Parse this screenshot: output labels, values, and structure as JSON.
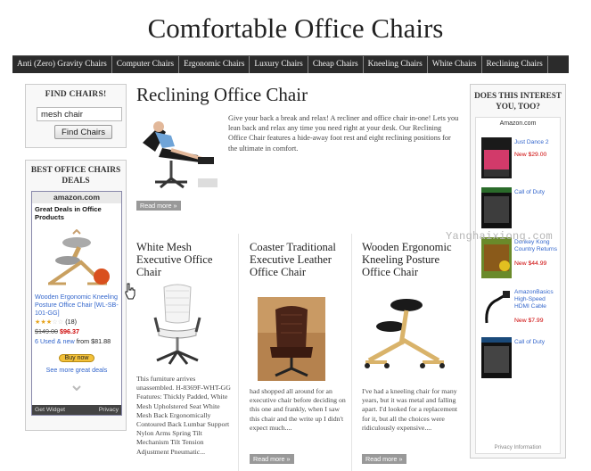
{
  "site": {
    "title": "Comfortable Office Chairs"
  },
  "nav": [
    "Anti (Zero) Gravity Chairs",
    "Computer Chairs",
    "Ergonomic Chairs",
    "Luxury Chairs",
    "Cheap Chairs",
    "Kneeling Chairs",
    "White Chairs",
    "Reclining Chairs"
  ],
  "find": {
    "title": "FIND CHAIRS!",
    "value": "mesh chair",
    "button": "Find Chairs"
  },
  "deals": {
    "title": "BEST OFFICE CHAIRS DEALS",
    "logo": "amazon.com",
    "subtitle": "Great Deals in Office Products",
    "product": "Wooden Ergonomic Kneeling Posture Office Chair [WL-SB-101-GG]",
    "rating_count": "(18)",
    "price_old": "$149.00",
    "price_new": "$96.37",
    "used_new_link": "6 Used & new",
    "used_new_from": "from $81.88",
    "buy_button": "Buy now",
    "see_more": "See more great deals",
    "footer_left": "Get Widget",
    "footer_right": "Privacy"
  },
  "main": {
    "title": "Reclining Office Chair",
    "text": "Give your back a break and relax! A recliner and office chair in-one! Lets you lean back and relax any time you need right at your desk. Our Reclining Office Chair features a hide-away foot rest and eight reclining positions for the ultimate in comfort.",
    "read_more": "Read more »"
  },
  "columns": [
    {
      "title": "White Mesh Executive Office Chair",
      "text": "This furniture arrives unassembled. H-8369F-WHT-GG Features: Thickly Padded, White Mesh Upholstered Seat White Mesh Back Ergonomically Contoured Back Lumbar Support Nylon Arms Spring Tilt Mechanism Tilt Tension Adjustment Pneumatic...",
      "read_more": ""
    },
    {
      "title": "Coaster Traditional Executive Leather Office Chair",
      "text": "had shopped all around for an executive chair before deciding on this one and frankly, when I saw this chair and the write up I didn't expect much....",
      "read_more": "Read more »"
    },
    {
      "title": "Wooden Ergonomic Kneeling Posture Office Chair",
      "text": "I've had a kneeling chair for many years, but it was metal and falling apart. I'd looked for a replacement for it, but all the choices were ridiculously expensive....",
      "read_more": "Read more »"
    }
  ],
  "right": {
    "title": "DOES THIS INTEREST YOU, TOO?",
    "logo": "Amazon.com",
    "items": [
      {
        "name": "Just Dance 2",
        "price": "New $29.00"
      },
      {
        "name": "Call of Duty",
        "price": ""
      },
      {
        "name": "Donkey Kong Country Returns",
        "price": "New $44.99"
      },
      {
        "name": "AmazonBasics High-Speed HDMI Cable",
        "price": "New $7.99"
      },
      {
        "name": "Call of Duty",
        "price": ""
      }
    ],
    "privacy": "Privacy Information"
  },
  "watermark": "Yanghaixiong.com",
  "colors": {
    "nav_bg": "#2b2b2b",
    "link": "#3366cc",
    "price": "#cc0000",
    "button_gray": "#999999"
  }
}
